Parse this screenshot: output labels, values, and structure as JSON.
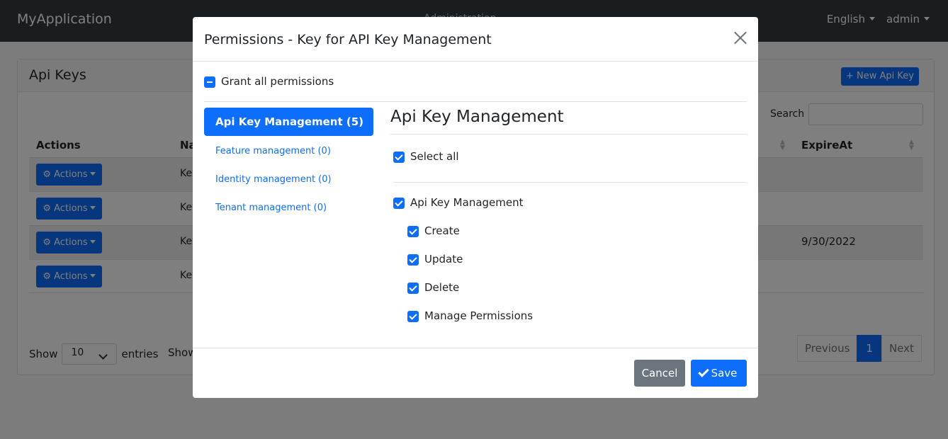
{
  "navbar": {
    "brand": "MyApplication",
    "center_item": "Administration",
    "language": "English",
    "user": "admin"
  },
  "card": {
    "title": "Api Keys",
    "new_button": "New Api Key",
    "search_label": "Search",
    "columns": {
      "actions": "Actions",
      "name": "Na",
      "expire": "ExpireAt"
    },
    "rows": [
      {
        "action": "Actions",
        "name": "Key",
        "expire": ""
      },
      {
        "action": "Actions",
        "name": "Key",
        "expire": ""
      },
      {
        "action": "Actions",
        "name": "Key",
        "expire": "9/30/2022"
      },
      {
        "action": "Actions",
        "name": "Key",
        "expire": ""
      }
    ],
    "show_label": "Show",
    "page_size": "10",
    "entries_label": "entries",
    "show_label_2": "Show",
    "pagination": {
      "previous": "Previous",
      "current": "1",
      "next": "Next"
    }
  },
  "modal": {
    "title": "Permissions - Key for API Key Management",
    "grant_all": "Grant all permissions",
    "tabs": [
      "Api Key Management (5)",
      "Feature management (0)",
      "Identity management (0)",
      "Tenant management (0)"
    ],
    "group_title": "Api Key Management",
    "select_all": "Select all",
    "parent_permission": "Api Key Management",
    "child_permissions": [
      "Create",
      "Update",
      "Delete",
      "Manage Permissions"
    ],
    "cancel": "Cancel",
    "save": "Save"
  },
  "colors": {
    "primary": "#0d6efd",
    "secondary": "#6c757d",
    "navbar": "#343a40"
  },
  "icons": [
    "gear-icon",
    "close-icon",
    "check-icon",
    "plus-icon"
  ]
}
